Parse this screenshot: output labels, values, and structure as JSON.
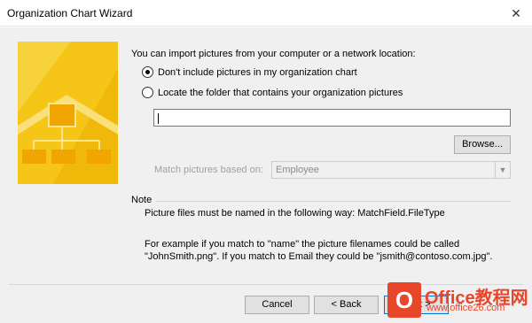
{
  "window": {
    "title": "Organization Chart Wizard",
    "close_glyph": "✕"
  },
  "intro": "You can import pictures from your computer or a network location:",
  "options": [
    {
      "label": "Don't include pictures in my organization chart",
      "checked": true
    },
    {
      "label": "Locate the folder that contains your organization pictures",
      "checked": false
    }
  ],
  "folder_path": {
    "value": ""
  },
  "browse_label": "Browse...",
  "match": {
    "label": "Match pictures based on:",
    "value": "Employee"
  },
  "note": {
    "heading": "Note",
    "text": "Picture files must be named in the following way: MatchField.FileType",
    "example_line1": "For example if you match to \"name\" the picture filenames could be called",
    "example_line2": "\"JohnSmith.png\". If you match to Email they could be \"jsmith@contoso.com.jpg\"."
  },
  "buttons": {
    "cancel": "Cancel",
    "back": "< Back",
    "next": "Next >"
  },
  "watermark": {
    "brand": "Office教程网",
    "url": "www.office26.com"
  },
  "colors": {
    "art_yellow": "#f5c518",
    "accent": "#0078d7",
    "watermark": "#e8462a"
  }
}
